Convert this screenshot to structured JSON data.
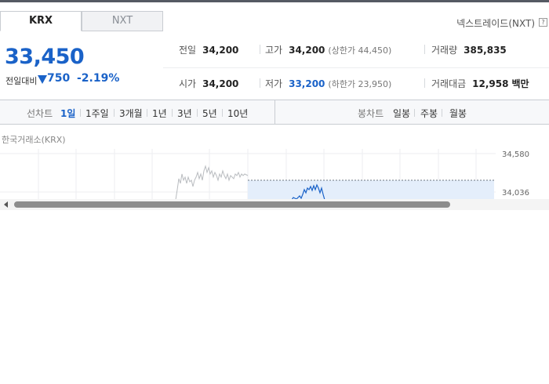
{
  "tabs": {
    "active": "KRX",
    "inactive": "NXT"
  },
  "nxt_link": "넥스트레이드(NXT)",
  "help_icon_glyph": "?",
  "price": {
    "current": "33,450",
    "change_label": "전일대비",
    "change_value": "750",
    "change_pct": "-2.19%",
    "direction": "down"
  },
  "stats": {
    "prev_close": {
      "label": "전일",
      "value": "34,200"
    },
    "high": {
      "label": "고가",
      "value": "34,200",
      "sub": "(상한가 44,450)"
    },
    "volume": {
      "label": "거래량",
      "value": "385,835"
    },
    "open": {
      "label": "시가",
      "value": "34,200"
    },
    "low": {
      "label": "저가",
      "value": "33,200",
      "sub": "(하한가 23,950)"
    },
    "amount": {
      "label": "거래대금",
      "value": "12,958",
      "unit": "백만"
    }
  },
  "period_bar": {
    "line_chart_label": "선차트",
    "line_periods": [
      "1일",
      "1주일",
      "3개월",
      "1년",
      "3년",
      "5년",
      "10년"
    ],
    "selected": "1일",
    "candle_label": "봉차트",
    "candle_periods": [
      "일봉",
      "주봉",
      "월봉"
    ]
  },
  "exchange_label": "한국거래소(KRX)",
  "chart_data": {
    "type": "line",
    "y_ticks": [
      "34,580",
      "34,036"
    ],
    "prev_close_line": 34200,
    "colors": {
      "gray_series": "#b9bcc0",
      "blue_series": "#1a62c8",
      "fill": "#e4eefb"
    }
  }
}
